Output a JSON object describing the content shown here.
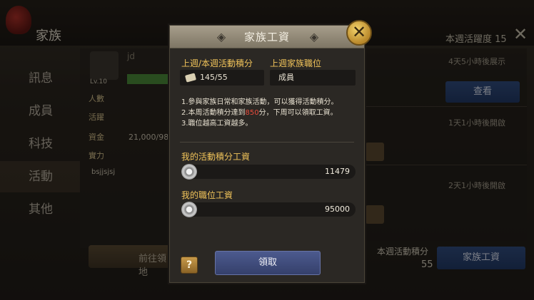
{
  "background": {
    "header_title": "家族",
    "week_activity": "本週活躍度 15",
    "sidebar": [
      "訊息",
      "成員",
      "科技",
      "活動",
      "其他"
    ],
    "guild_name": "jd",
    "level": "Lv.10",
    "info_labels": [
      "人數",
      "活躍",
      "資金",
      "實力"
    ],
    "fund_value": "21,000/98",
    "member_name": "bsjjsjsj",
    "goto_label": "前往領地",
    "timers": [
      "4天5小時後展示",
      "1天1小時後開啟",
      "2天1小時後開啟"
    ],
    "view_label": "查看",
    "week_points_label": "本週活動積分",
    "week_points_value": "55",
    "salary_button_label": "家族工資"
  },
  "dialog": {
    "title": "家族工資",
    "points_label": "上週/本週活動積分",
    "points_value": "145/55",
    "position_label": "上週家族職位",
    "position_value": "成員",
    "rules": {
      "line1": "1.參與家族日常和家族活動，可以獲得活動積分。",
      "line2_pre": "2.本周活動積分達到",
      "line2_num": "850",
      "line2_post": "分，下周可以領取工資。",
      "line3": "3.職位越高工資越多。"
    },
    "activity_salary_label": "我的活動積分工資",
    "activity_salary_value": "11479",
    "position_salary_label": "我的職位工資",
    "position_salary_value": "95000",
    "help_label": "?",
    "claim_label": "領取"
  },
  "colors": {
    "accent_gold": "#f0c35a",
    "highlight_red": "#e84b3c",
    "button_blue": "#4c5a8e"
  }
}
